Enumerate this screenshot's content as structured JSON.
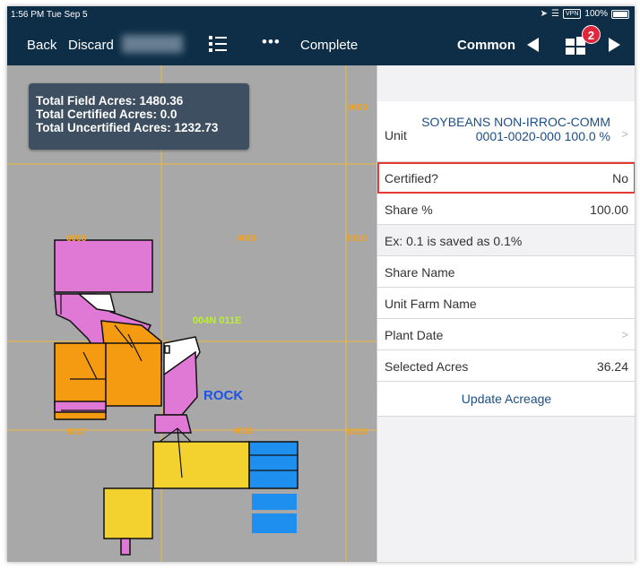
{
  "status_bar": {
    "time": "1:56 PM  Tue Sep 5",
    "vpn": "VPN",
    "battery": "100%"
  },
  "nav": {
    "back": "Back",
    "discard": "Discard",
    "more": "•••",
    "complete": "Complete",
    "common": "Common",
    "badge_count": "2"
  },
  "map": {
    "info": {
      "field_acres": "Total Field Acres: 1480.36",
      "certified_acres": "Total Certified Acres: 0.0",
      "uncertified_acres": "Total Uncertified Acres: 1232.73"
    },
    "section_labels": {
      "s0003": "0003",
      "s0008": "0008",
      "s0009": "0009",
      "s0010": "0010",
      "s0016": "0016",
      "s0017": "0017",
      "s0015": "0015"
    },
    "township_label": "004N 011E",
    "rock_label": "ROCK"
  },
  "panel": {
    "unit_label": "Unit",
    "unit_value": "SOYBEANS NON-IRROC-COMM 0001-0020-000 100.0 %",
    "certified_label": "Certified?",
    "certified_value": "No",
    "share_label": "Share %",
    "share_value": "100.00",
    "share_note": "Ex: 0.1 is saved as 0.1%",
    "share_name_label": "Share Name",
    "unit_farm_name_label": "Unit Farm Name",
    "plant_date_label": "Plant Date",
    "selected_acres_label": "Selected Acres",
    "selected_acres_value": "36.24",
    "update_button": "Update Acreage"
  },
  "colors": {
    "nav_bg": "#0e2e47",
    "map_bg": "#a8a8a8",
    "pink": "#e079d6",
    "orange": "#f59b12",
    "yellow": "#f3d230",
    "blue": "#1f8fef",
    "accent": "#1c4e86",
    "highlight": "#e53935"
  }
}
